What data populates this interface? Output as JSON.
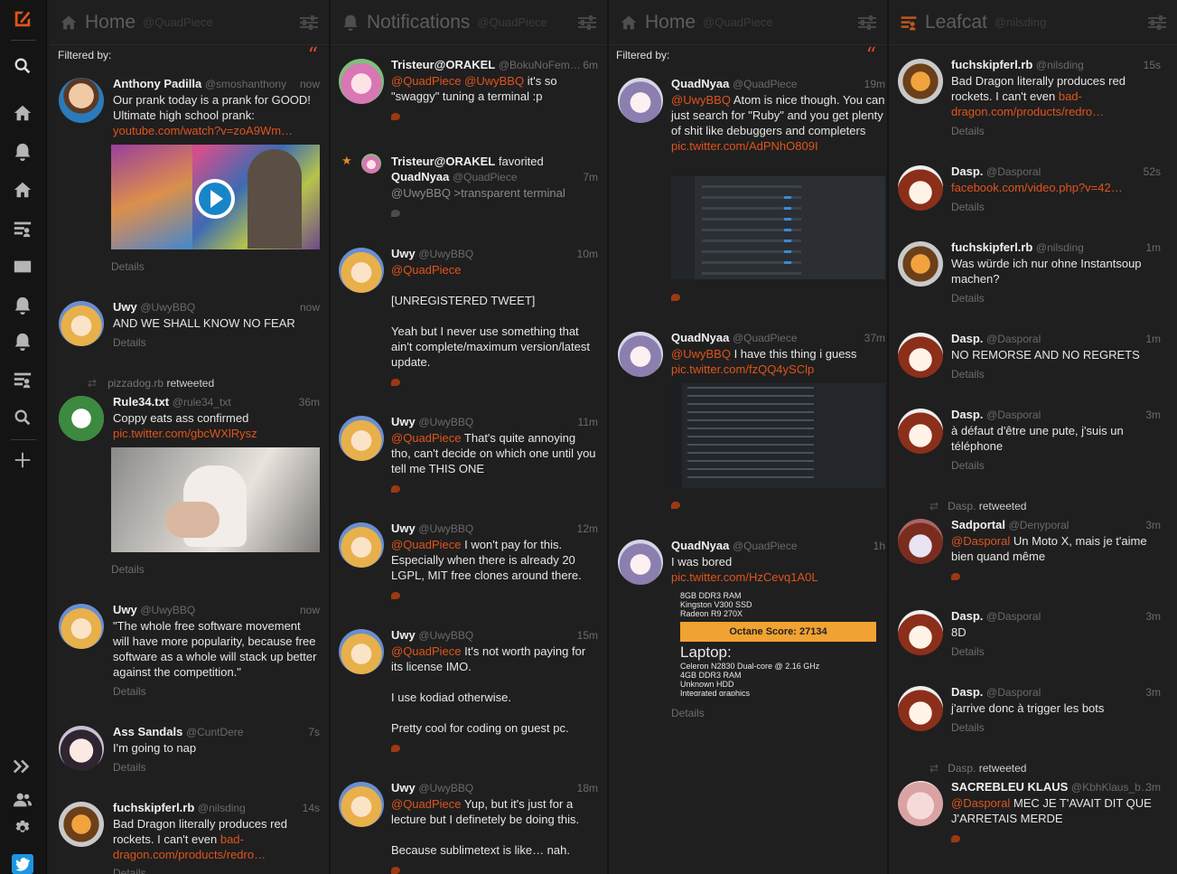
{
  "nav": {
    "icons": [
      "logo",
      "search-icon",
      "home-icon",
      "notifications-icon",
      "home-icon",
      "list-icon",
      "messages-icon",
      "notifications-icon",
      "notifications-icon",
      "list-icon",
      "search-icon",
      "add-column-icon",
      "expand-icon",
      "accounts-icon",
      "settings-icon",
      "twitter-icon"
    ]
  },
  "columns": [
    {
      "title": "Home",
      "sub": "@QuadPiece",
      "icon": "home-icon",
      "filter": "Filtered by:",
      "tweets": [
        {
          "name": "Anthony Padilla",
          "handle": "@smoshanthony",
          "time": "now",
          "text": "Our prank today is a prank for GOOD! Ultimate high school prank:",
          "link": "youtube.com/watch?v=zoA9Wm…",
          "details": "Details"
        },
        {
          "name": "Uwy",
          "handle": "@UwyBBQ",
          "time": "now",
          "text": "AND WE SHALL KNOW NO FEAR",
          "details": "Details"
        },
        {
          "rt_by": "pizzadog.rb",
          "rt_word": "retweeted",
          "name": "Rule34.txt",
          "handle": "@rule34_txt",
          "time": "36m",
          "text": "Coppy eats ass confirmed",
          "link": "pic.twitter.com/gbcWXlRysz",
          "details": "Details"
        },
        {
          "name": "Uwy",
          "handle": "@UwyBBQ",
          "time": "now",
          "text": "\"The whole free software movement will have more popularity, because free software as a whole will stack up better against the competition.\"",
          "details": "Details"
        },
        {
          "name": "Ass Sandals",
          "handle": "@CuntDere",
          "time": "7s",
          "text": "I'm going to nap",
          "details": "Details"
        },
        {
          "name": "fuchskipferl.rb",
          "handle": "@nilsding",
          "time": "14s",
          "text": "Bad Dragon literally produces red rockets.  I can't even",
          "link": "bad-dragon.com/products/redro…",
          "details": "Details"
        }
      ]
    },
    {
      "title": "Notifications",
      "sub": "@QuadPiece",
      "icon": "notifications-icon",
      "tweets": [
        {
          "name": "Tristeur@ORAKEL",
          "handle": "@BokuNoFem…",
          "time": "6m",
          "mention": "@QuadPiece",
          "mention2": "@UwyBBQ",
          "text": "it's so \"swaggy\" tuning a terminal :p"
        },
        {
          "name": "Tristeur@ORAKEL",
          "action": "favorited",
          "target": "QuadNyaa",
          "target_handle": "@QuadPiece",
          "time": "7m",
          "text": "@UwyBBQ >transparent terminal"
        },
        {
          "name": "Uwy",
          "handle": "@UwyBBQ",
          "time": "10m",
          "mention": "@QuadPiece",
          "text": "[UNREGISTERED TWEET]",
          "text2": "Yeah but I never use something that ain't complete/maximum version/latest update."
        },
        {
          "name": "Uwy",
          "handle": "@UwyBBQ",
          "time": "11m",
          "mention": "@QuadPiece",
          "text": "That's quite annoying tho, can't decide on which one until you tell me THIS ONE"
        },
        {
          "name": "Uwy",
          "handle": "@UwyBBQ",
          "time": "12m",
          "mention": "@QuadPiece",
          "text": "I won't pay for this. Especially when there is already 20 LGPL, MIT free clones around there."
        },
        {
          "name": "Uwy",
          "handle": "@UwyBBQ",
          "time": "15m",
          "mention": "@QuadPiece",
          "text": "It's not worth paying for its license IMO.",
          "text2": "I use kodiad otherwise.",
          "text3": "Pretty cool for coding on guest pc."
        },
        {
          "name": "Uwy",
          "handle": "@UwyBBQ",
          "time": "18m",
          "mention": "@QuadPiece",
          "text": "Yup, but it's just for a lecture but I definetely be doing this.",
          "text2": "Because sublimetext is like… nah."
        }
      ]
    },
    {
      "title": "Home",
      "sub": "@QuadPiece",
      "icon": "home-icon",
      "filter": "Filtered by:",
      "tweets": [
        {
          "name": "QuadNyaa",
          "handle": "@QuadPiece",
          "time": "19m",
          "mention": "@UwyBBQ",
          "text": "Atom is nice though. You can just search for \"Ruby\" and you get plenty of shit like debuggers and completers",
          "link": "pic.twitter.com/AdPNhO809I"
        },
        {
          "name": "QuadNyaa",
          "handle": "@QuadPiece",
          "time": "37m",
          "mention": "@UwyBBQ",
          "text": "I have this thing i guess",
          "link": "pic.twitter.com/fzQQ4ySClp"
        },
        {
          "name": "QuadNyaa",
          "handle": "@QuadPiece",
          "time": "1h",
          "text": "I was bored",
          "link": "pic.twitter.com/HzCevq1A0L",
          "details": "Details",
          "img_lines": [
            "8GB DDR3 RAM",
            "Kingston V300 SSD",
            "Radeon R9 270X"
          ],
          "img_score": "Octane Score: 27134",
          "img_title": "Laptop:",
          "img_lines2": [
            "Celeron N2830 Dual-core @ 2.16 GHz",
            "4GB DDR3 RAM",
            "Unknown HDD",
            "Integrated graphics"
          ]
        }
      ]
    },
    {
      "title": "Leafcat",
      "sub": "@nilsding",
      "icon": "list-icon",
      "tweets": [
        {
          "name": "fuchskipferl.rb",
          "handle": "@nilsding",
          "time": "15s",
          "text": "Bad Dragon literally produces red rockets.  I can't even",
          "link": "bad-dragon.com/products/redro…",
          "details": "Details"
        },
        {
          "name": "Dasp.",
          "handle": "@Dasporal",
          "time": "52s",
          "link": "facebook.com/video.php?v=42…",
          "details": "Details"
        },
        {
          "name": "fuchskipferl.rb",
          "handle": "@nilsding",
          "time": "1m",
          "text": "Was würde ich nur ohne Instantsoup machen?",
          "details": "Details"
        },
        {
          "name": "Dasp.",
          "handle": "@Dasporal",
          "time": "1m",
          "text": "NO REMORSE AND NO REGRETS",
          "details": "Details"
        },
        {
          "name": "Dasp.",
          "handle": "@Dasporal",
          "time": "3m",
          "text": "à défaut d'être une pute, j'suis un téléphone",
          "details": "Details"
        },
        {
          "rt_by": "Dasp.",
          "rt_word": "retweeted",
          "name": "Sadportal",
          "handle": "@Denyporal",
          "time": "3m",
          "mention": "@Dasporal",
          "text": "Un Moto X, mais je t'aime bien quand même"
        },
        {
          "name": "Dasp.",
          "handle": "@Dasporal",
          "time": "3m",
          "text": "8D",
          "details": "Details"
        },
        {
          "name": "Dasp.",
          "handle": "@Dasporal",
          "time": "3m",
          "text": "j'arrive donc à trigger les bots",
          "details": "Details"
        },
        {
          "rt_by": "Dasp.",
          "rt_word": "retweeted",
          "name": "SACREBLEU KLAUS",
          "handle": "@KbhKlaus_b…",
          "time": "3m",
          "mention": "@Dasporal",
          "text": "MEC JE T'AVAIT DIT QUE J'ARRETAIS MERDE"
        }
      ]
    }
  ],
  "colors": {
    "accent": "#e0541c",
    "bg": "#1f1f1f",
    "nav": "#141414"
  }
}
